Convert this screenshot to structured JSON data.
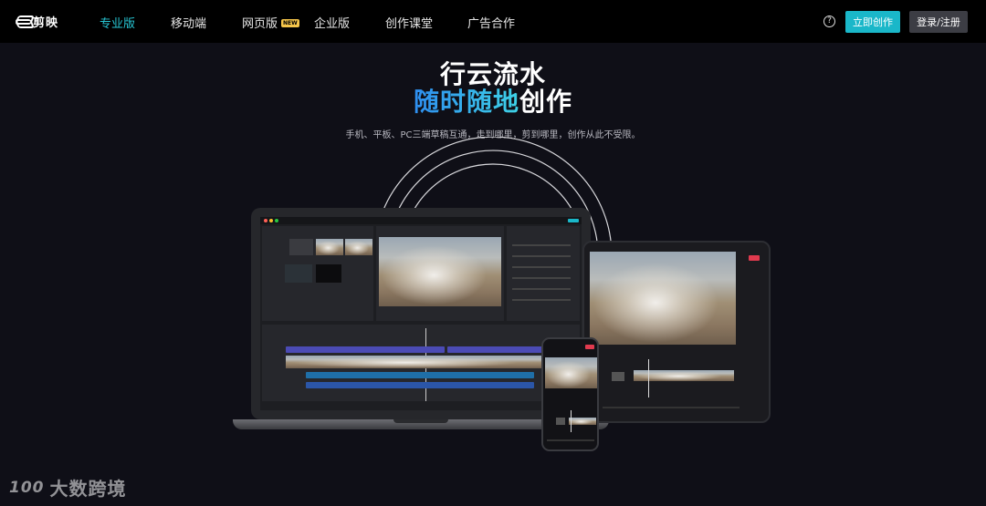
{
  "nav": {
    "logo_text": "剪映",
    "items": [
      {
        "label": "专业版",
        "active": true
      },
      {
        "label": "移动端"
      },
      {
        "label": "网页版",
        "badge": "NEW"
      },
      {
        "label": "企业版"
      },
      {
        "label": "创作课堂"
      },
      {
        "label": "广告合作"
      }
    ],
    "help_icon": "?",
    "create_button": "立即创作",
    "login_button": "登录/注册"
  },
  "hero": {
    "line1": "行云流水",
    "line2_highlight": "随时随地",
    "line2_rest": "创作",
    "subtitle": "手机、平板、PC三端草稿互通，走到哪里，剪到哪里，创作从此不受限。"
  },
  "watermark": {
    "logo": "100",
    "text": "大数跨境"
  },
  "colors": {
    "accent": "#1ab7c9",
    "active_nav": "#27c6d4",
    "background": "#0f0f17"
  }
}
